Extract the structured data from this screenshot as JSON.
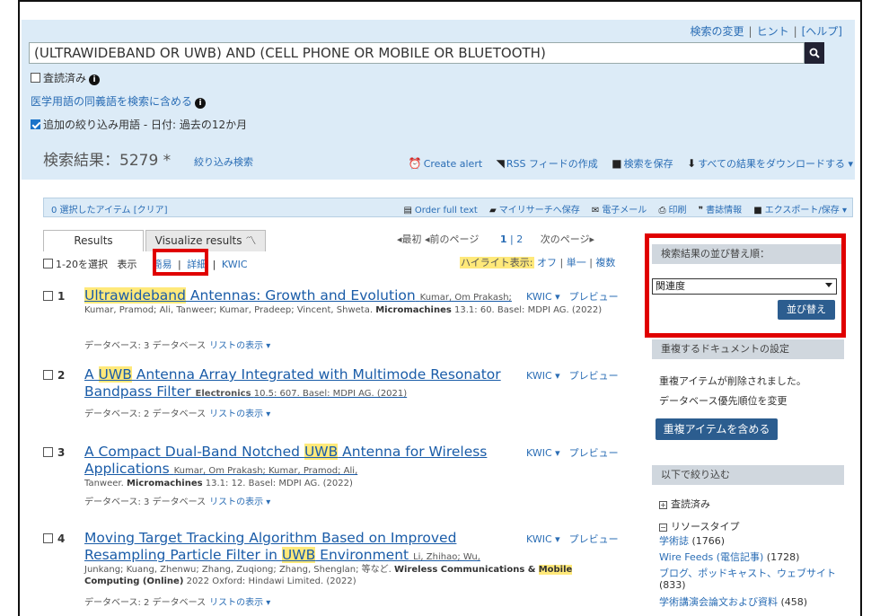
{
  "search": {
    "top_links": [
      "検索の変更",
      "ヒント",
      "[ヘルプ]"
    ],
    "query": "(ULTRAWIDEBAND OR UWB) AND (CELL PHONE OR MOBILE OR BLUETOOTH)",
    "peer_reviewed": "査読済み",
    "medical_synonyms": "医学用語の同義語を検索に含める",
    "additional_terms": "追加の絞り込み用語 - 日付: 過去の12か月"
  },
  "results_header": {
    "count_label": "検索結果：5279 *",
    "narrow": "絞り込み検索",
    "actions": [
      "Create alert",
      "RSS フィードの作成",
      "検索を保存",
      "すべての結果をダウンロードする ▾"
    ]
  },
  "selection_bar": {
    "selected": "0 選択したアイテム [クリア]",
    "actions": [
      "Order full text",
      "マイリサーチへ保存",
      "電子メール",
      "印刷",
      "書誌情報",
      "エクスポート/保存 ▾"
    ]
  },
  "tabs": [
    "Results",
    "Visualize results"
  ],
  "pager": {
    "first": "◂最初",
    "prev": "◂前のページ",
    "page1": "1",
    "sep": "|",
    "page2": "2",
    "next": "次のページ▸"
  },
  "view": {
    "select": "1-20を選択",
    "show": "表示",
    "brief": "簡易",
    "detail": "詳細",
    "kwic": "KWIC"
  },
  "highlight": {
    "label": "ハイライト表示:",
    "off": "オフ",
    "single": "単一",
    "multiple": "複数"
  },
  "results": [
    {
      "num": "1",
      "t1": "",
      "t1h": "Ultrawideband",
      "t2": " Antennas: Growth and Evolution",
      "authors_inline": "Kumar, Om Prakash;",
      "meta": "Kumar, Pramod; Ali, Tanweer; Kumar, Pradeep; Vincent, Shweta.",
      "journal": "Micromachines",
      "pub": "13.1: 60. Basel: MDPI AG. (2022)",
      "db": "データベース: 3 データベース",
      "db_link": "リストの表示 ▾"
    },
    {
      "num": "2",
      "t1": "A ",
      "t1h": "UWB",
      "t2": " Antenna Array Integrated with Multimode Resonator Bandpass Filter",
      "journal": "Electronics",
      "pub": "10.5: 607. Basel: MDPI AG. (2021)",
      "db": "データベース: 2 データベース",
      "db_link": "リストの表示 ▾"
    },
    {
      "num": "3",
      "t1": "A Compact Dual-Band Notched ",
      "t1h": "UWB",
      "t2": " Antenna for Wireless Applications",
      "authors_inline": "Kumar, Om Prakash; Kumar, Pramod; Ali,",
      "meta": "Tanweer.",
      "journal": "Micromachines",
      "pub": "13.1: 12. Basel: MDPI AG. (2022)",
      "db": "データベース: 3 データベース",
      "db_link": "リストの表示 ▾"
    },
    {
      "num": "4",
      "t1": "Moving Target Tracking Algorithm Based on Improved Resampling Particle Filter in ",
      "t1h": "UWB",
      "t2": " Environment",
      "authors_inline": "Li, Zhihao; Wu,",
      "meta": "Junkang; Kuang, Zhenwu; Zhang, Zuqiong; Zhang, Shenglan; 等など.",
      "journal": "Wireless Communications &",
      "journal_hl": "Mobile",
      "journal2": "Computing (Online)",
      "pub": "2022 Oxford: Hindawi Limited. (2022)",
      "db": "データベース: 2 データベース",
      "db_link": "リストの表示 ▾"
    }
  ],
  "kwic": {
    "label": "KWIC ▾",
    "preview": "プレビュー"
  },
  "sidebar": {
    "sort_header": "検索結果の並び替え順：",
    "sort_value": "関連度",
    "sort_button": "並び替え",
    "dup_header": "重複するドキュメントの設定",
    "dup_text": "重複アイテムが削除されました。",
    "dup_link": "データベース優先順位を変更",
    "dup_button": "重複アイテムを含める",
    "narrow_header": "以下で絞り込む",
    "facet1": "査読済み",
    "facet2": "リソースタイプ",
    "facet_items": [
      {
        "label": "学術誌",
        "count": "(1766)"
      },
      {
        "label": "Wire Feeds (電信記事)",
        "count": "(1728)"
      },
      {
        "label": "ブログ、ポッドキャスト、ウェブサイト",
        "count": "(833)"
      },
      {
        "label": "学術講演会論文および資料",
        "count": "(458)"
      }
    ]
  }
}
